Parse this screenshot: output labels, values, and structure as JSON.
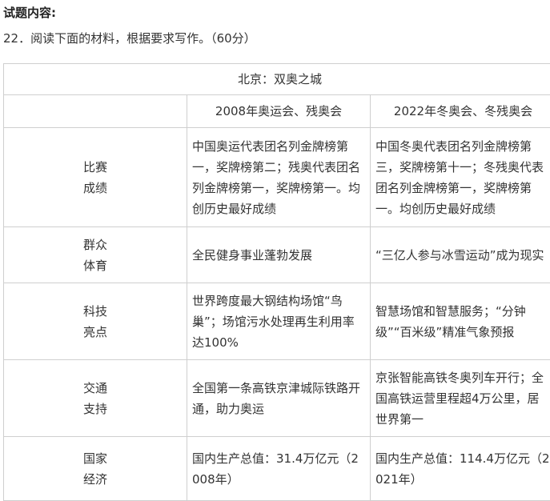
{
  "heading": "试题内容:",
  "question": "22．阅读下面的材料，根据要求写作。（60分）",
  "table": {
    "caption": "北京：双奥之城",
    "headers": [
      "",
      "2008年奥运会、残奥会",
      "2022年冬奥会、冬残奥会"
    ],
    "rows": [
      {
        "label": [
          "比赛",
          "成绩"
        ],
        "col1": "中国奥运代表团名列金牌榜第一，奖牌榜第二；残奥代表团名列金牌榜第一，奖牌榜第一。均创历史最好成绩",
        "col2": "中国冬奥代表团名列金牌榜第三，奖牌榜第十一；冬残奥代表团名列金牌榜第一，奖牌榜第一。均创历史最好成绩"
      },
      {
        "label": [
          "群众",
          "体育"
        ],
        "col1": "全民健身事业蓬勃发展",
        "col2": "“三亿人参与冰雪运动”成为现实"
      },
      {
        "label": [
          "科技",
          "亮点"
        ],
        "col1": "世界跨度最大钢结构场馆“鸟巢”；场馆污水处理再生利用率达100%",
        "col2": "智慧场馆和智慧服务；“分钟级”“百米级”精准气象预报"
      },
      {
        "label": [
          "交通",
          "支持"
        ],
        "col1": "全国第一条高铁京津城际铁路开通，助力奥运",
        "col2": "京张智能高铁冬奥列车开行；全国高铁运营里程超4万公里，居世界第一"
      },
      {
        "label": [
          "国家",
          "经济"
        ],
        "col1": "国内生产总值：31.4万亿元（2008年）",
        "col2": "国内生产总值：114.4万亿元（2021年）"
      }
    ]
  }
}
